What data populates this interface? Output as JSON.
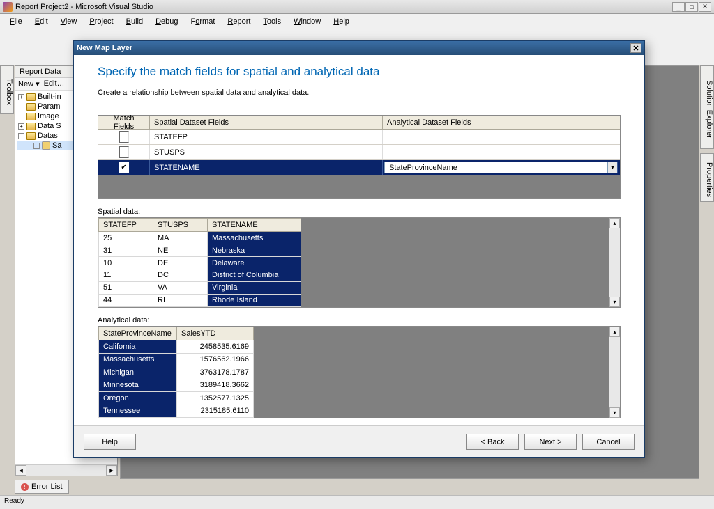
{
  "app": {
    "title": "Report Project2 - Microsoft Visual Studio",
    "status": "Ready"
  },
  "menus": {
    "file": "File",
    "edit": "Edit",
    "view": "View",
    "project": "Project",
    "build": "Build",
    "debug": "Debug",
    "format": "Format",
    "report": "Report",
    "tools": "Tools",
    "window": "Window",
    "help": "Help"
  },
  "panels": {
    "toolbox": "Toolbox",
    "solution_explorer": "Solution Explorer",
    "properties": "Properties",
    "report_data": "Report Data",
    "error_list": "Error List",
    "new_btn": "New",
    "edit_btn": "Edit…"
  },
  "tree": {
    "builtin": "Built-in",
    "parameters": "Param",
    "images": "Image",
    "datasources": "Data S",
    "datasets": "Datas",
    "ds_item": "Sa"
  },
  "dialog": {
    "title": "New Map Layer",
    "heading": "Specify the match fields for spatial and analytical data",
    "subheading": "Create a relationship between spatial data and analytical data.",
    "match_col0": "Match Fields",
    "match_col1": "Spatial Dataset Fields",
    "match_col2": "Analytical Dataset Fields",
    "match_rows": [
      {
        "checked": false,
        "spatial": "STATEFP",
        "analytical": ""
      },
      {
        "checked": false,
        "spatial": "STUSPS",
        "analytical": ""
      },
      {
        "checked": true,
        "spatial": "STATENAME",
        "analytical": "StateProvinceName"
      }
    ],
    "spatial_label": "Spatial data:",
    "spatial_cols": [
      "STATEFP",
      "STUSPS",
      "STATENAME"
    ],
    "spatial_rows": [
      {
        "fp": "25",
        "usps": "MA",
        "name": "Massachusetts"
      },
      {
        "fp": "31",
        "usps": "NE",
        "name": "Nebraska"
      },
      {
        "fp": "10",
        "usps": "DE",
        "name": "Delaware"
      },
      {
        "fp": "11",
        "usps": "DC",
        "name": "District of Columbia"
      },
      {
        "fp": "51",
        "usps": "VA",
        "name": "Virginia"
      },
      {
        "fp": "44",
        "usps": "RI",
        "name": "Rhode Island"
      }
    ],
    "analytical_label": "Analytical data:",
    "analytical_cols": [
      "StateProvinceName",
      "SalesYTD"
    ],
    "analytical_rows": [
      {
        "name": "California",
        "sales": "2458535.6169"
      },
      {
        "name": "Massachusetts",
        "sales": "1576562.1966"
      },
      {
        "name": "Michigan",
        "sales": "3763178.1787"
      },
      {
        "name": "Minnesota",
        "sales": "3189418.3662"
      },
      {
        "name": "Oregon",
        "sales": "1352577.1325"
      },
      {
        "name": "Tennessee",
        "sales": "2315185.6110"
      }
    ],
    "btn_help": "Help",
    "btn_back": "< Back",
    "btn_next": "Next >",
    "btn_cancel": "Cancel"
  }
}
